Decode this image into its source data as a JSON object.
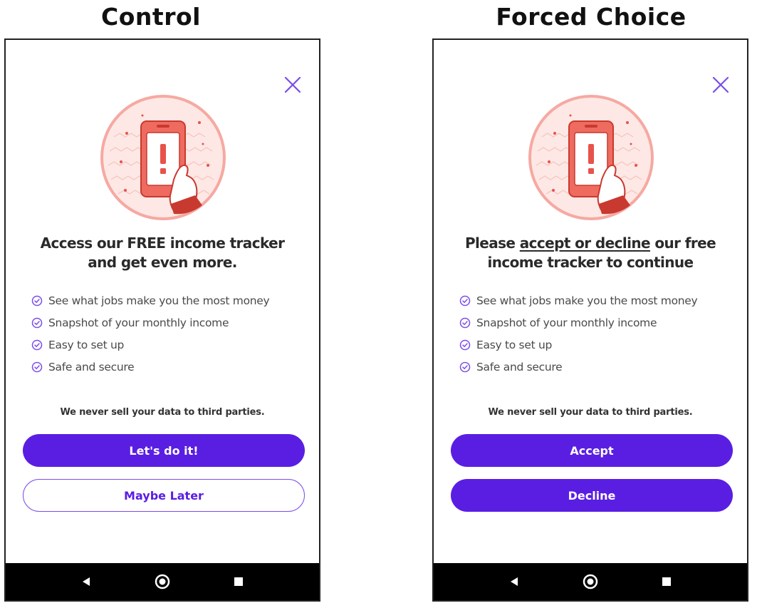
{
  "control": {
    "title": "Control",
    "headline_line1": "Access our FREE income tracker",
    "headline_line2": "and get even more.",
    "benefits": [
      "See what jobs make you the most money",
      "Snapshot of your monthly income",
      "Easy to set up",
      "Safe and secure"
    ],
    "privacy_note": "We never sell your data to third parties.",
    "primary_button": "Let's do it!",
    "secondary_button": "Maybe Later"
  },
  "forced_choice": {
    "title": "Forced Choice",
    "headline_prefix": "Please ",
    "headline_underlined": "accept or decline",
    "headline_suffix": " our free",
    "headline_line2": "income tracker to continue",
    "benefits": [
      "See what jobs make you the most money",
      "Snapshot of your monthly income",
      "Easy to set up",
      "Safe and secure"
    ],
    "privacy_note": "We never sell your data to third parties.",
    "accept_button": "Accept",
    "decline_button": "Decline"
  },
  "icons": {
    "close": "close-icon",
    "check": "check-circle-icon",
    "illustration": "phone-alert-illustration",
    "nav_back": "back-triangle-icon",
    "nav_home": "home-circle-icon",
    "nav_recents": "recents-square-icon"
  },
  "colors": {
    "primary": "#5a1ee3",
    "close_icon": "#7b4de8",
    "illustration_red": "#e8524a",
    "illustration_bg": "#fde3e0"
  }
}
